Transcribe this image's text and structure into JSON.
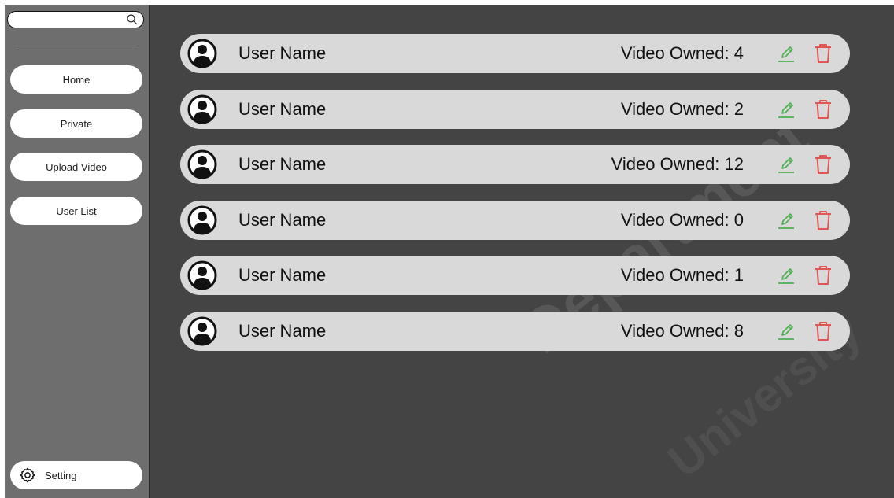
{
  "search": {
    "placeholder": "",
    "value": ""
  },
  "sidebar": {
    "items": [
      {
        "label": "Home"
      },
      {
        "label": "Private"
      },
      {
        "label": "Upload Video"
      },
      {
        "label": "User List"
      }
    ],
    "setting_label": "Setting"
  },
  "users": [
    {
      "name": "User Name",
      "videos": "Video Owned: 4"
    },
    {
      "name": "User Name",
      "videos": "Video Owned: 2"
    },
    {
      "name": "User Name",
      "videos": "Video Owned: 12"
    },
    {
      "name": "User Name",
      "videos": "Video Owned: 0"
    },
    {
      "name": "User Name",
      "videos": "Video Owned: 1"
    },
    {
      "name": "User Name",
      "videos": "Video Owned: 8"
    }
  ],
  "watermark": {
    "line1": "Department",
    "line2": "University"
  },
  "colors": {
    "edit": "#4caf50",
    "delete": "#e05555",
    "row_bg": "#d9d9d9",
    "sidebar_bg": "#6e6e6e",
    "main_bg": "#444444"
  },
  "icons": {
    "search": "search-icon",
    "avatar": "user-avatar-icon",
    "edit": "pencil-icon",
    "delete": "trash-icon",
    "setting": "gear-icon"
  }
}
